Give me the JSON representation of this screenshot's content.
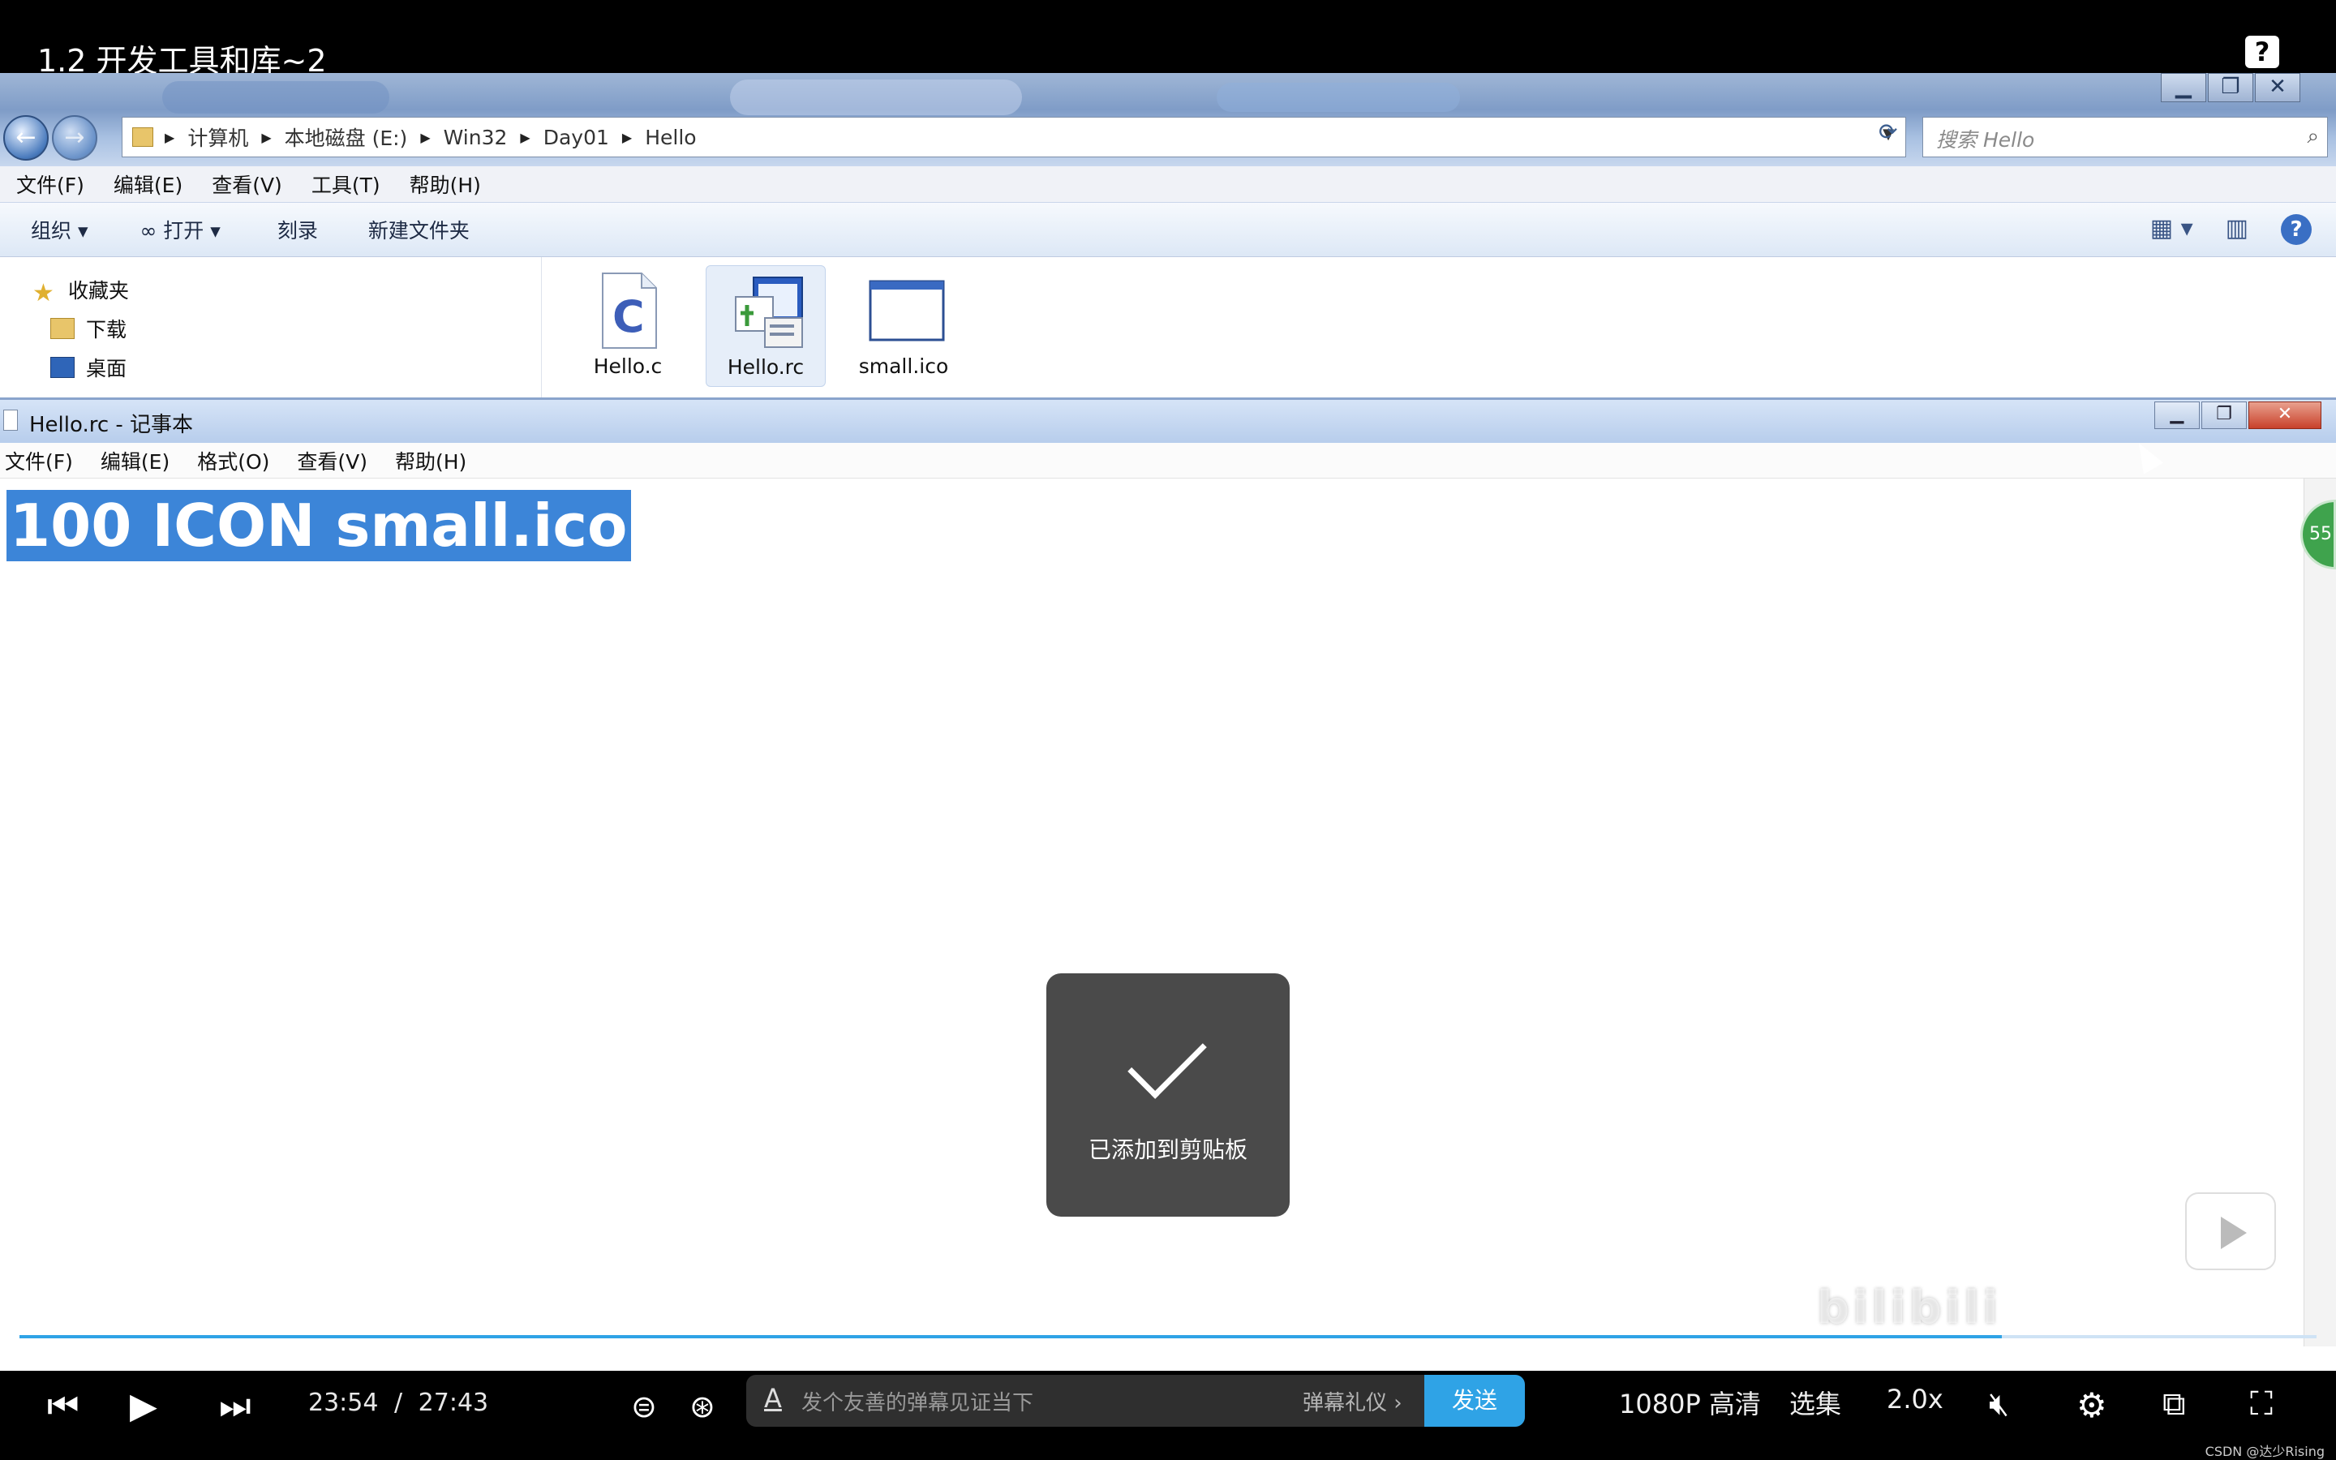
{
  "video": {
    "title": "1.2 开发工具和库~2",
    "help_icon": "?"
  },
  "explorer": {
    "address": {
      "crumbs": [
        "计算机",
        "本地磁盘 (E:)",
        "Win32",
        "Day01",
        "Hello"
      ]
    },
    "search_placeholder": "搜索 Hello",
    "menu": [
      "文件(F)",
      "编辑(E)",
      "查看(V)",
      "工具(T)",
      "帮助(H)"
    ],
    "toolbar": {
      "organize": "组织",
      "open": "打开",
      "burn": "刻录",
      "new_folder": "新建文件夹"
    },
    "nav": {
      "favorites": "收藏夹",
      "downloads": "下载",
      "desktop": "桌面"
    },
    "files": [
      "Hello.c",
      "Hello.rc",
      "small.ico"
    ]
  },
  "notepad": {
    "title": "Hello.rc - 记事本",
    "menu": [
      "文件(F)",
      "编辑(E)",
      "格式(O)",
      "查看(V)",
      "帮助(H)"
    ],
    "content": "100 ICON small.ico",
    "badge": "55"
  },
  "toast": {
    "message": "已添加到剪贴板"
  },
  "player": {
    "current_time": "23:54",
    "separator": "/",
    "duration": "27:43",
    "danmaku_placeholder": "发个友善的弹幕见证当下",
    "danmaku_etiquette": "弹幕礼仪 ›",
    "send": "发送",
    "quality": "1080P 高清",
    "episodes": "选集",
    "speed": "2.0x",
    "progress_fraction": 0.863,
    "credit": "CSDN @达少Rising",
    "accent": "#2fa3e6"
  }
}
